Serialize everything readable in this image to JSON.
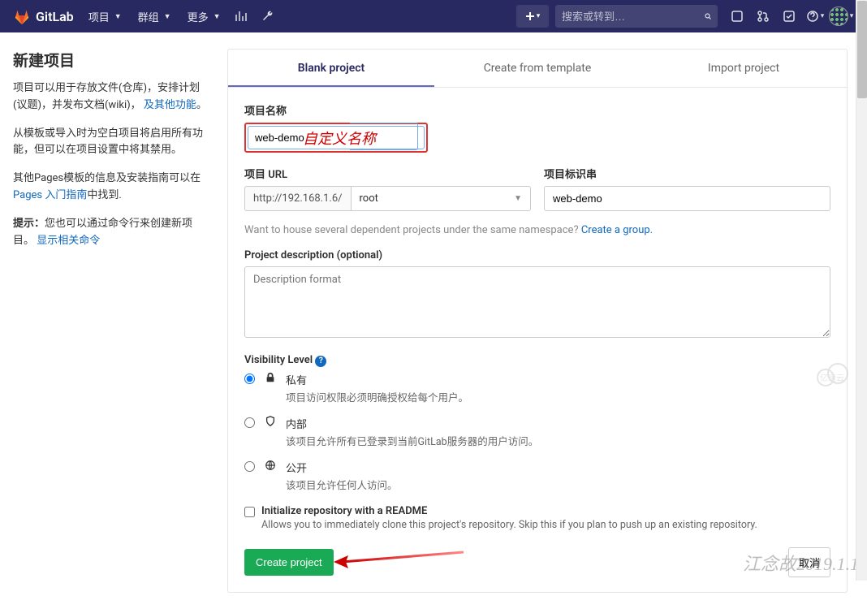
{
  "navbar": {
    "brand": "GitLab",
    "menu_project": "项目",
    "menu_group": "群组",
    "menu_more": "更多",
    "search_placeholder": "搜索或转到…"
  },
  "sidebar": {
    "title": "新建项目",
    "p1_pre": "项目可以用于存放文件(仓库)，安排计划(议题)，并发布文档(wiki)， ",
    "p1_link": "及其他功能",
    "p1_post": "。",
    "p2": "从模板或导入时为空白项目将启用所有功能，但可以在项目设置中将其禁用。",
    "p3_pre": "其他Pages模板的信息及安装指南可以在 ",
    "p3_link": "Pages 入门指南",
    "p3_post": "中找到.",
    "tip_label": "提示：",
    "tip_text": "您也可以通过命令行来创建新项目。",
    "tip_link": "显示相关命令"
  },
  "tabs": {
    "blank": "Blank project",
    "template": "Create from template",
    "import": "Import project"
  },
  "form": {
    "name_label": "项目名称",
    "name_value": "web-demo",
    "name_annotation": "自定义名称",
    "url_label": "项目 URL",
    "url_prefix": "http://192.168.1.6/",
    "url_namespace": "root",
    "slug_label": "项目标识串",
    "slug_value": "web-demo",
    "group_hint_pre": "Want to house several dependent projects under the same namespace? ",
    "group_hint_link": "Create a group.",
    "desc_label": "Project description (optional)",
    "desc_placeholder": "Description format",
    "visibility_label": "Visibility Level",
    "vis_private_title": "私有",
    "vis_private_desc": "项目访问权限必须明确授权给每个用户。",
    "vis_internal_title": "内部",
    "vis_internal_desc": "该项目允许所有已登录到当前GitLab服务器的用户访问。",
    "vis_public_title": "公开",
    "vis_public_desc": "该项目允许任何人访问。",
    "readme_label": "Initialize repository with a README",
    "readme_desc": "Allows you to immediately clone this project's repository. Skip this if you plan to push up an existing repository.",
    "create_btn": "Create project",
    "cancel_btn": "取消"
  },
  "watermark": "江念故2019.1.1"
}
